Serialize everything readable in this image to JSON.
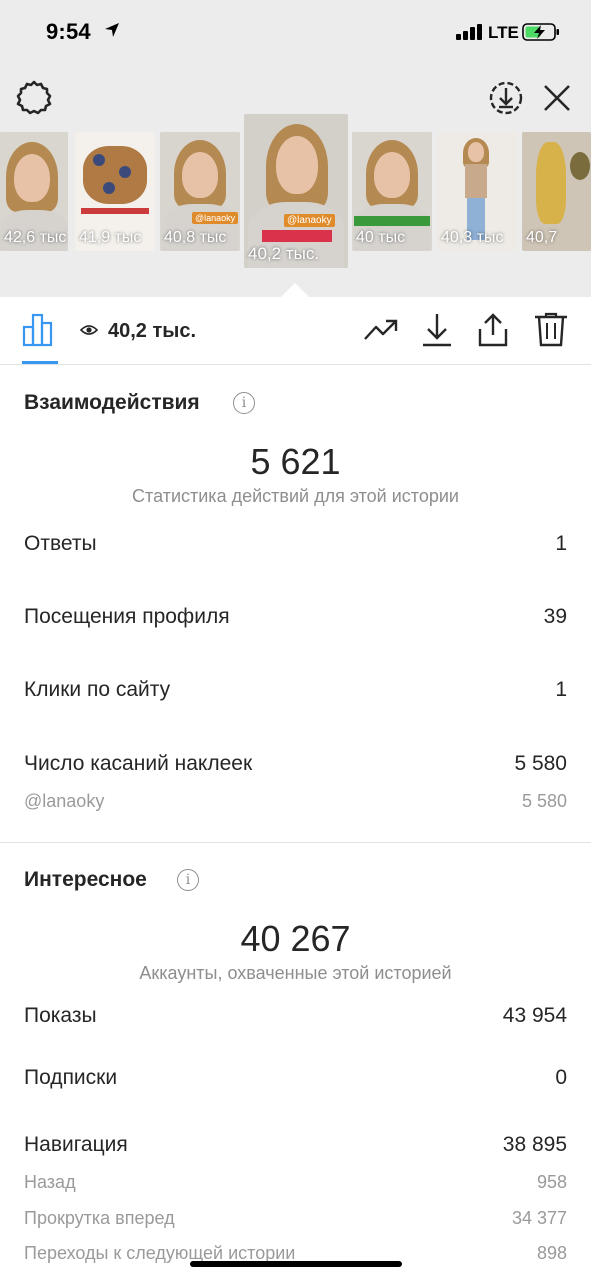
{
  "status_bar": {
    "time": "9:54",
    "network": "LTE"
  },
  "thumbnails": [
    {
      "views": "42,6 тыс"
    },
    {
      "views": "41,9 тыс"
    },
    {
      "views": "40,8 тыс"
    },
    {
      "views": "40,2 тыс.",
      "tag": "@lanaoky"
    },
    {
      "views": "40 тыс"
    },
    {
      "views": "40,3 тыс"
    },
    {
      "views": "40,7"
    }
  ],
  "toolbar": {
    "views_count": "40,2 тыс."
  },
  "interactions": {
    "title": "Взаимодействия",
    "total": "5 621",
    "caption": "Статистика действий для этой истории",
    "rows": [
      {
        "label": "Ответы",
        "value": "1"
      },
      {
        "label": "Посещения профиля",
        "value": "39"
      },
      {
        "label": "Клики по сайту",
        "value": "1"
      },
      {
        "label": "Число касаний наклеек",
        "value": "5 580"
      }
    ],
    "sub_rows": [
      {
        "label": "@lanaoky",
        "value": "5 580"
      }
    ]
  },
  "discovery": {
    "title": "Интересное",
    "total": "40 267",
    "caption": "Аккаунты, охваченные этой историей",
    "rows": [
      {
        "label": "Показы",
        "value": "43 954"
      },
      {
        "label": "Подписки",
        "value": "0"
      },
      {
        "label": "Навигация",
        "value": "38 895"
      }
    ],
    "sub_rows": [
      {
        "label": "Назад",
        "value": "958"
      },
      {
        "label": "Прокрутка вперед",
        "value": "34 377"
      },
      {
        "label": "Переходы к следующей истории",
        "value": "898"
      }
    ]
  },
  "colors": {
    "accent": "#3897f0",
    "top_background": "#ececec",
    "muted_text": "#8e8e8e"
  }
}
